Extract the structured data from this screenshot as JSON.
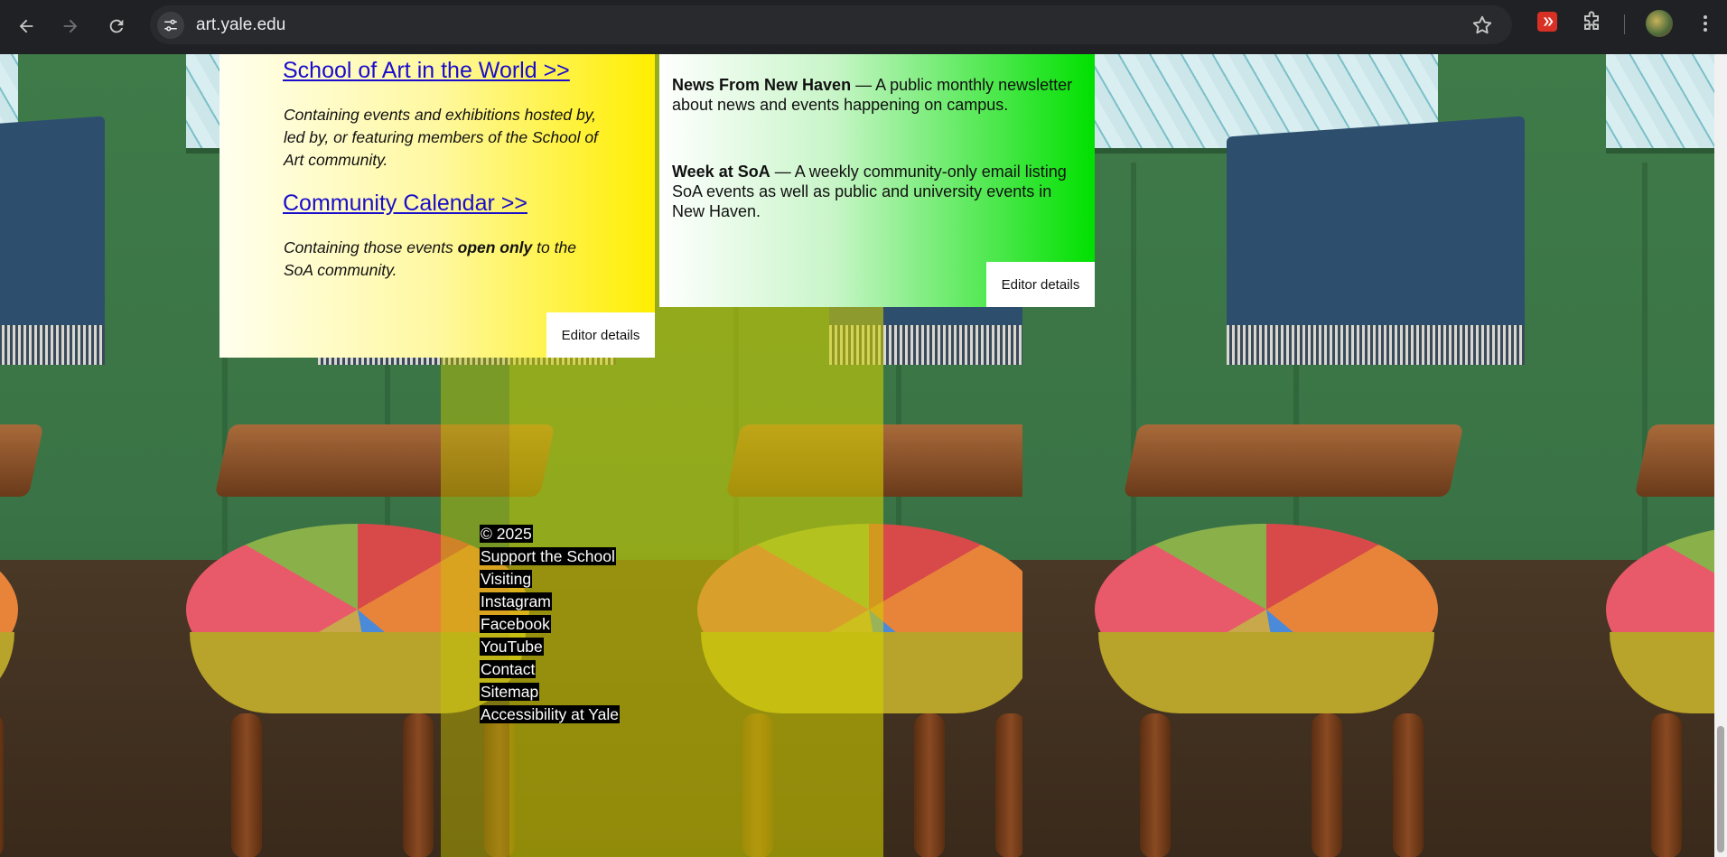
{
  "browser": {
    "url": "art.yale.edu",
    "icons": {
      "back": "arrow-left-icon",
      "forward": "arrow-right-icon",
      "reload": "reload-icon",
      "site_info": "tune-icon",
      "bookmark": "star-icon",
      "pdf_extension": "pdf-icon",
      "extensions": "puzzle-icon",
      "profile": "avatar",
      "menu": "kebab-menu-icon"
    }
  },
  "card_left": {
    "link1": "School of Art in the World >>",
    "desc1": "Containing events and exhibitions hosted by, led by, or featuring members of the School of Art community.",
    "link2": "Community Calendar >>",
    "desc2_pre": "Containing those events ",
    "desc2_bold": "open only",
    "desc2_post": " to the SoA community.",
    "editor_button": "Editor details",
    "gradient": [
      "#ffffee",
      "#ffee00"
    ]
  },
  "card_right": {
    "item1_title": "News From New Haven",
    "item1_text": " — A public monthly newsletter about news and events happening on campus.",
    "item2_title": "Week at SoA",
    "item2_text": " — A weekly community-only email listing SoA events as well as public and university events in New Haven.",
    "editor_button": "Editor details",
    "gradient": [
      "#ffffff",
      "#00e000"
    ]
  },
  "footer": {
    "items": [
      "© 2025",
      "Support the School",
      "Visiting",
      "Instagram",
      "Facebook",
      "YouTube",
      "Contact",
      "Sitemap",
      "Accessibility at Yale"
    ]
  },
  "colors": {
    "link": "#1a0dcc",
    "chrome_bg": "#202124",
    "overlay": "#c8c800"
  }
}
